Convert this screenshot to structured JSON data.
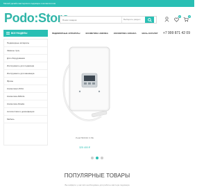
{
  "topbar": {
    "text": "Мягкий дизайн мастерского педикюра и косметология"
  },
  "logo": {
    "text": "Podo:Store"
  },
  "search": {
    "placeholder": "Поиск товаров",
    "category": "Выберите раздел"
  },
  "header_icons": {
    "cart_count": "0",
    "wishlist_count": "0",
    "icons": [
      "user-icon",
      "heart-icon",
      "cart-icon"
    ]
  },
  "catalog_button": {
    "label": "ВСЕ РАЗДЕЛЫ"
  },
  "nav": {
    "items": [
      "ПЕДИКЮРНЫЕ АППАРАТЫ",
      "КОСМЕТИКА ANDREA",
      "КОСМЕТИКА ARKADA",
      "ВЕСЬ КАТАЛОГ"
    ]
  },
  "phone": {
    "text": "+7 999 871 42 09"
  },
  "sidebar": {
    "items": [
      "Педикюрные аппараты",
      "Замены пуль",
      "Для оборудования",
      "Инструменты для педикюра",
      "Инструменты для маникюра",
      "Фрезы",
      "Косметика LIKKA",
      "Косметика Allbirds",
      "Косметика Arkada",
      "Антисептики и дезинфекция",
      "Мебель"
    ]
  },
  "featured": {
    "name": "PodoTRONIC 3 PE",
    "price": "325 400 ₽"
  },
  "section": {
    "title": "ПОПУЛЯРНЫЕ ТОВАРЫ",
    "subtitle": "Вы найдёте у нас всё необходимое для работы мастера педикюра"
  },
  "colors": {
    "accent": "#29bfb4",
    "logo": "#2fb5a8"
  }
}
